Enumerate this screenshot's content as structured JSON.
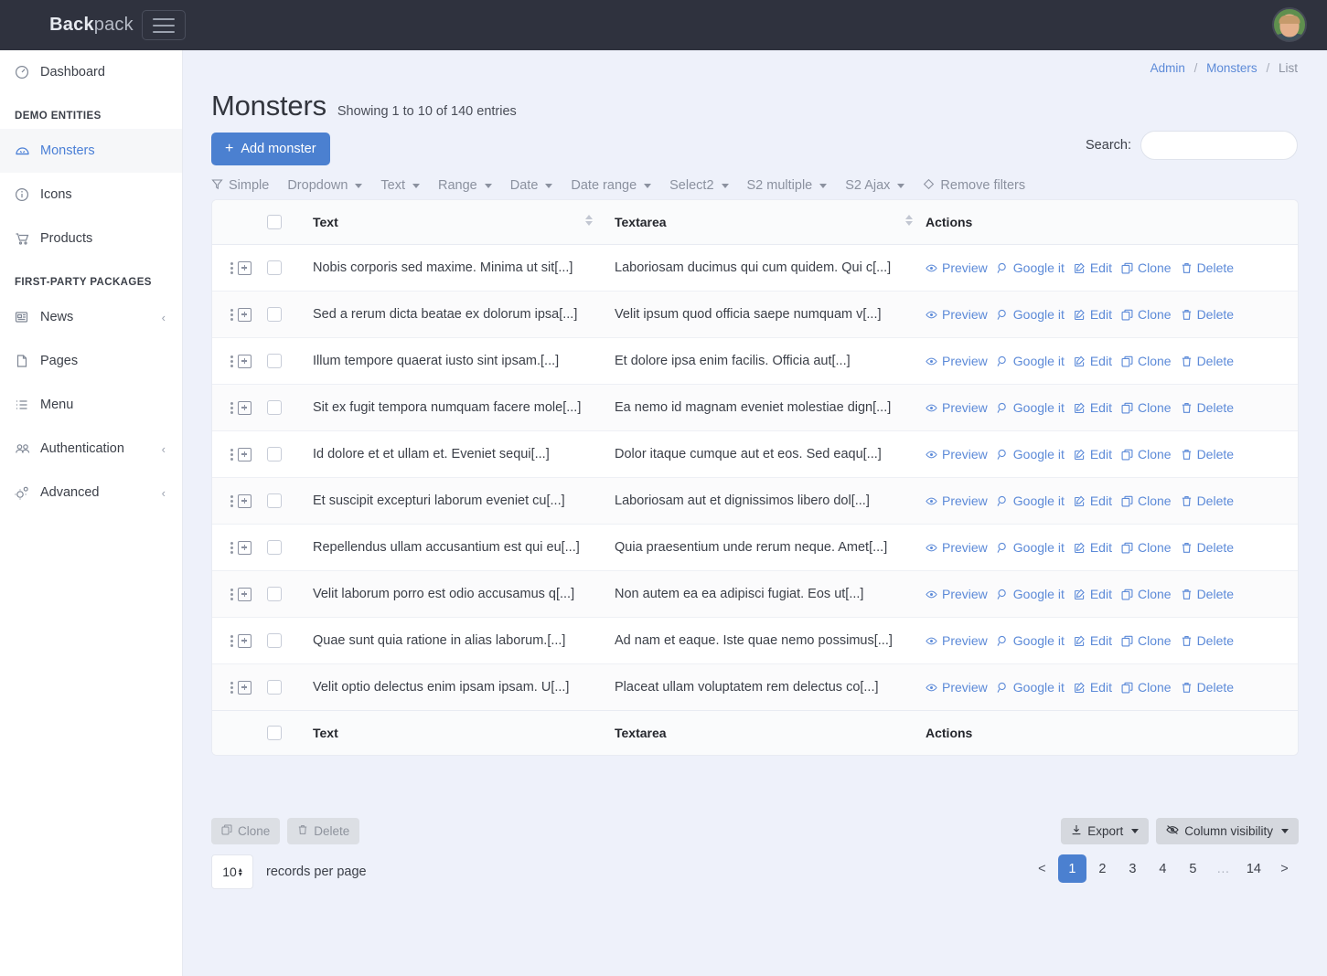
{
  "topbar": {
    "brand_bold": "Back",
    "brand_light": "pack",
    "menu_toggle": "menu-toggle",
    "avatar_alt": "user-avatar"
  },
  "sidebar": {
    "dashboard": {
      "label": "Dashboard",
      "icon": "dashboard-icon"
    },
    "groups": [
      {
        "heading": "DEMO ENTITIES",
        "items": [
          {
            "label": "Monsters",
            "icon": "monster-icon",
            "active": true,
            "caret": ""
          },
          {
            "label": "Icons",
            "icon": "info-icon",
            "active": false,
            "caret": ""
          },
          {
            "label": "Products",
            "icon": "cart-icon",
            "active": false,
            "caret": ""
          }
        ]
      },
      {
        "heading": "FIRST-PARTY PACKAGES",
        "items": [
          {
            "label": "News",
            "icon": "news-icon",
            "active": false,
            "caret": "‹"
          },
          {
            "label": "Pages",
            "icon": "page-icon",
            "active": false,
            "caret": ""
          },
          {
            "label": "Menu",
            "icon": "list-icon",
            "active": false,
            "caret": ""
          },
          {
            "label": "Authentication",
            "icon": "users-icon",
            "active": false,
            "caret": "‹"
          },
          {
            "label": "Advanced",
            "icon": "gears-icon",
            "active": false,
            "caret": "‹"
          }
        ]
      }
    ]
  },
  "breadcrumb": {
    "admin": "Admin",
    "entity": "Monsters",
    "current": "List",
    "sep": "/"
  },
  "page": {
    "title": "Monsters",
    "subtitle": "Showing 1 to 10 of 140 entries",
    "add_button": "Add monster",
    "add_plus": "+"
  },
  "search": {
    "label": "Search:",
    "value": "",
    "placeholder": ""
  },
  "filters": [
    {
      "label": "Simple",
      "icon": "funnel-icon",
      "dropdown": false
    },
    {
      "label": "Dropdown",
      "icon": "",
      "dropdown": true
    },
    {
      "label": "Text",
      "icon": "",
      "dropdown": true
    },
    {
      "label": "Range",
      "icon": "",
      "dropdown": true
    },
    {
      "label": "Date",
      "icon": "",
      "dropdown": true
    },
    {
      "label": "Date range",
      "icon": "",
      "dropdown": true
    },
    {
      "label": "Select2",
      "icon": "",
      "dropdown": true
    },
    {
      "label": "S2 multiple",
      "icon": "",
      "dropdown": true
    },
    {
      "label": "S2 Ajax",
      "icon": "",
      "dropdown": true
    },
    {
      "label": "Remove filters",
      "icon": "eraser-icon",
      "dropdown": false
    }
  ],
  "table": {
    "columns": {
      "text": "Text",
      "textarea": "Textarea",
      "actions": "Actions"
    },
    "rows": [
      {
        "text": "Nobis corporis sed maxime. Minima ut sit[...]",
        "textarea": "Laboriosam ducimus qui cum quidem. Qui c[...]"
      },
      {
        "text": "Sed a rerum dicta beatae ex dolorum ipsa[...]",
        "textarea": "Velit ipsum quod officia saepe numquam v[...]"
      },
      {
        "text": "Illum tempore quaerat iusto sint ipsam.[...]",
        "textarea": "Et dolore ipsa enim facilis. Officia aut[...]"
      },
      {
        "text": "Sit ex fugit tempora numquam facere mole[...]",
        "textarea": "Ea nemo id magnam eveniet molestiae dign[...]"
      },
      {
        "text": "Id dolore et et ullam et. Eveniet sequi[...]",
        "textarea": "Dolor itaque cumque aut et eos. Sed eaqu[...]"
      },
      {
        "text": "Et suscipit excepturi laborum eveniet cu[...]",
        "textarea": "Laboriosam aut et dignissimos libero dol[...]"
      },
      {
        "text": "Repellendus ullam accusantium est qui eu[...]",
        "textarea": "Quia praesentium unde rerum neque. Amet[...]"
      },
      {
        "text": "Velit laborum porro est odio accusamus q[...]",
        "textarea": "Non autem ea ea adipisci fugiat. Eos ut[...]"
      },
      {
        "text": "Quae sunt quia ratione in alias laborum.[...]",
        "textarea": "Ad nam et eaque. Iste quae nemo possimus[...]"
      },
      {
        "text": "Velit optio delectus enim ipsam ipsam. U[...]",
        "textarea": "Placeat ullam voluptatem rem delectus co[...]"
      }
    ],
    "row_actions": [
      {
        "label": "Preview",
        "icon": "eye-icon"
      },
      {
        "label": "Google it",
        "icon": "magnifier-icon"
      },
      {
        "label": "Edit",
        "icon": "pencil-square-icon"
      },
      {
        "label": "Clone",
        "icon": "copy-icon"
      },
      {
        "label": "Delete",
        "icon": "trash-icon"
      }
    ]
  },
  "bulk": {
    "clone": "Clone",
    "delete": "Delete"
  },
  "tools": {
    "export": "Export",
    "column_visibility": "Column visibility"
  },
  "perpage": {
    "value": "10",
    "label": "records per page"
  },
  "pagination": {
    "prev": "<",
    "next": ">",
    "pages": [
      "1",
      "2",
      "3",
      "4",
      "5",
      "…",
      "14"
    ],
    "active": "1",
    "accent": "#4b80d0"
  }
}
